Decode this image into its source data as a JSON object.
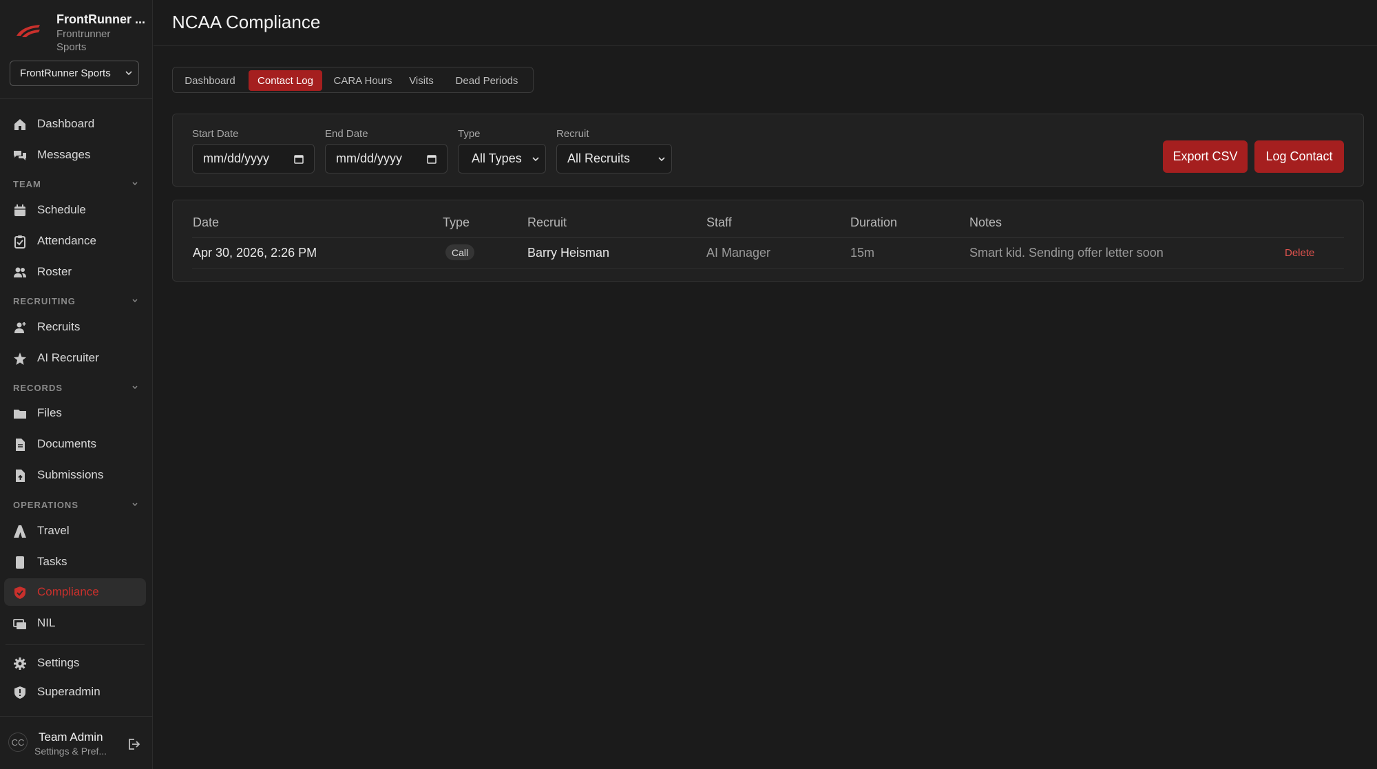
{
  "brand": {
    "name": "FrontRunner ...",
    "subtitle": "Frontrunner Sports",
    "logo_color": "#c9302c"
  },
  "org_select": {
    "value": "FrontRunner Sports"
  },
  "sidebar": {
    "top_items": [
      {
        "label": "Dashboard",
        "icon": "home-icon"
      },
      {
        "label": "Messages",
        "icon": "chat-icon"
      }
    ],
    "sections": {
      "team": {
        "title": "TEAM",
        "items": [
          "Schedule",
          "Attendance",
          "Roster"
        ]
      },
      "recruiting": {
        "title": "RECRUITING",
        "items": [
          "Recruits",
          "AI Recruiter"
        ]
      },
      "records": {
        "title": "RECORDS",
        "items": [
          "Files",
          "Documents",
          "Submissions"
        ]
      },
      "operations": {
        "title": "OPERATIONS",
        "items": [
          "Travel",
          "Tasks",
          "Compliance",
          "NIL"
        ]
      }
    },
    "bottom_items": [
      "Settings",
      "Superadmin"
    ],
    "active": "Compliance"
  },
  "user": {
    "initials": "CC",
    "name": "Team Admin",
    "subtitle": "Settings & Pref..."
  },
  "page": {
    "title": "NCAA Compliance"
  },
  "tabs": [
    "Dashboard",
    "Contact Log",
    "CARA Hours",
    "Visits",
    "Dead Periods"
  ],
  "active_tab": "Contact Log",
  "filters": {
    "start_date": {
      "label": "Start Date",
      "placeholder": "mm/dd/yyyy"
    },
    "end_date": {
      "label": "End Date",
      "placeholder": "mm/dd/yyyy"
    },
    "type": {
      "label": "Type",
      "value": "All Types"
    },
    "recruit": {
      "label": "Recruit",
      "value": "All Recruits"
    }
  },
  "actions": {
    "export": "Export CSV",
    "log": "Log Contact"
  },
  "table": {
    "columns": [
      "Date",
      "Type",
      "Recruit",
      "Staff",
      "Duration",
      "Notes"
    ],
    "rows": [
      {
        "date": "Apr 30, 2026, 2:26 PM",
        "type": "Call",
        "recruit": "Barry Heisman",
        "staff": "AI Manager",
        "duration": "15m",
        "notes": "Smart kid. Sending offer letter soon",
        "delete": "Delete"
      }
    ]
  },
  "colors": {
    "accent": "#a51f1f",
    "accent_text": "#c9302c",
    "background": "#1b1b1b"
  }
}
